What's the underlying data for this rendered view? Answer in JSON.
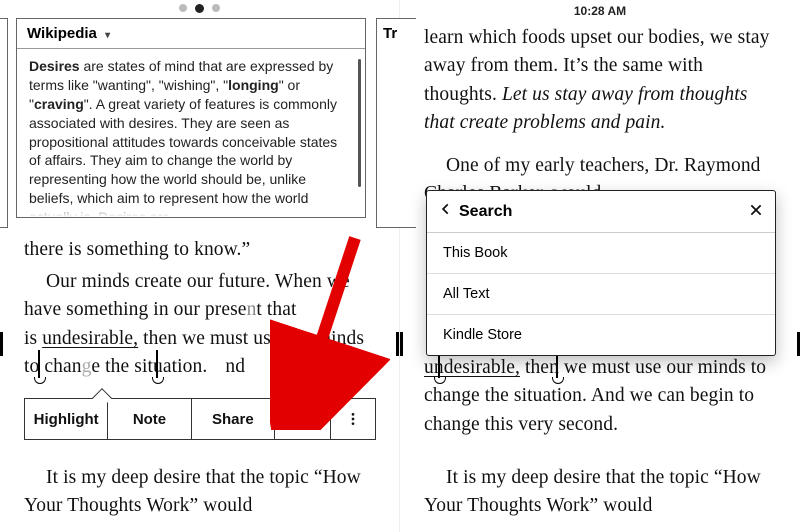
{
  "left": {
    "wikipedia": {
      "source_label": "Wikipedia",
      "entry_html": "<b>Desires</b> are states of mind that are expressed by terms like \"wanting\", \"wishing\", \"<b>longing</b>\" or \"<b>craving</b>\". A great variety of features is commonly associated with desires. They are seen as propositional attitudes towards conceivable states of affairs. They aim to change the world by representing how the world should be, unlike beliefs, which aim to represent how the world actually is. Desires are"
    },
    "truncated_tab": "Tr",
    "body": {
      "line1": "there is something to know.”",
      "para2_pre": "Our minds create our future. When we have something in our prese",
      "para2_post": "t that is ",
      "selected_word": "undesirable,",
      "para2_tail": " then we must us",
      "para2_tail2": " our minds to chan",
      "para2_tail3": "e the situation.",
      "para2_tail4": "nd",
      "para3": "It is my deep desire that the topic “How Your Thoughts Work” would"
    },
    "toolbar": {
      "highlight": "Highlight",
      "note": "Note",
      "share": "Share"
    }
  },
  "right": {
    "clock": "10:28 AM",
    "body": {
      "para0": "learn which foods upset our bodies, we stay away from them. It’s the same with thoughts. ",
      "para0_em": "Let us stay away from thoughts that create problems and pain.",
      "para1": "One of my early teachers, Dr. Raymond Charles Barker, would",
      "behind_tail": "”",
      "para3_pre": "",
      "selected_word": "undesirable,",
      "para3_mid": "minds to change the situation. And we can begin to change this very second.",
      "para4": "It is my deep desire that the topic “How Your Thoughts Work” would"
    },
    "search": {
      "title": "Search",
      "items": [
        "This Book",
        "All Text",
        "Kindle Store"
      ]
    }
  }
}
